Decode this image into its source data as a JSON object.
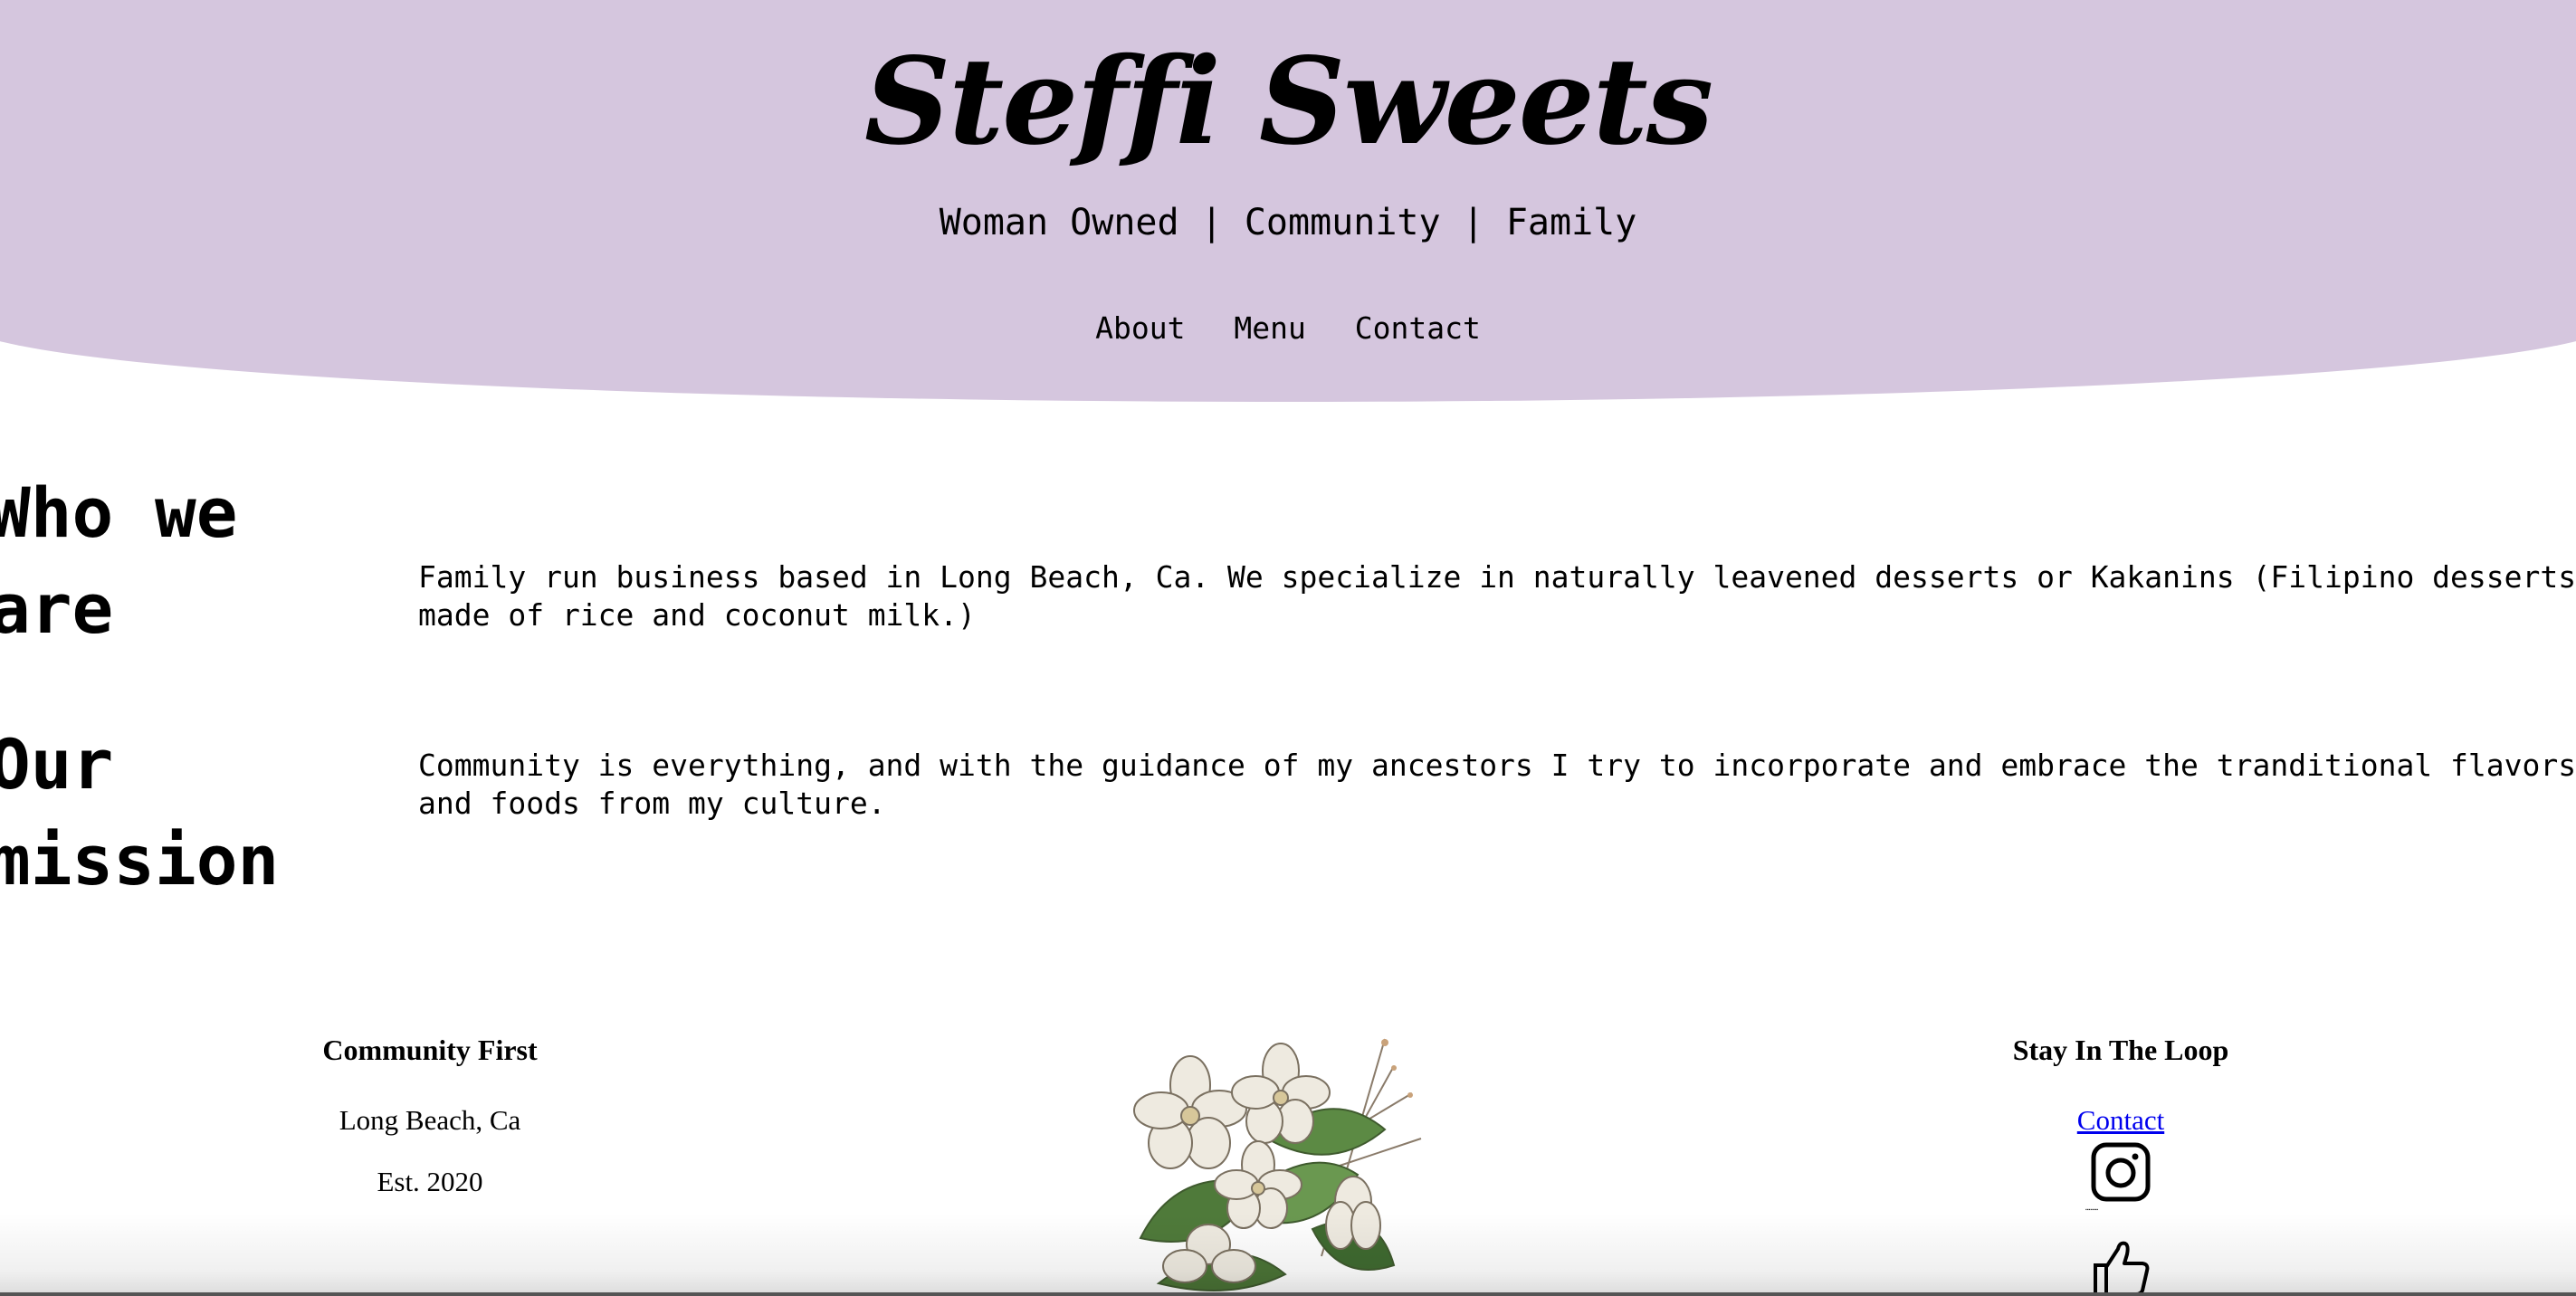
{
  "header": {
    "title": "Steffi Sweets",
    "tagline": "Woman Owned | Community | Family",
    "nav": [
      {
        "label": "About"
      },
      {
        "label": "Menu"
      },
      {
        "label": "Contact"
      }
    ],
    "bg_color": "#d5c6de"
  },
  "sections": [
    {
      "title_line1": "Who we",
      "title_line2": "are",
      "text": "Family run business based in Long Beach, Ca. We specialize in naturally leavened desserts or Kakanins (Filipino desserts made of rice and coconut milk.)"
    },
    {
      "title_line1": "Our",
      "title_line2": "mission",
      "text": "Community is everything, and with the guidance of my ancestors I try to incorporate and embrace the tranditional flavors and foods from my culture."
    }
  ],
  "footer": {
    "left": {
      "heading": "Community First",
      "line1": "Long Beach, Ca",
      "line2": "Est. 2020"
    },
    "center": {
      "image": "flower-bouquet-illustration"
    },
    "right": {
      "heading": "Stay In The Loop",
      "link": "Contact",
      "icons": [
        "instagram-icon",
        "thumbs-up-icon"
      ]
    }
  }
}
